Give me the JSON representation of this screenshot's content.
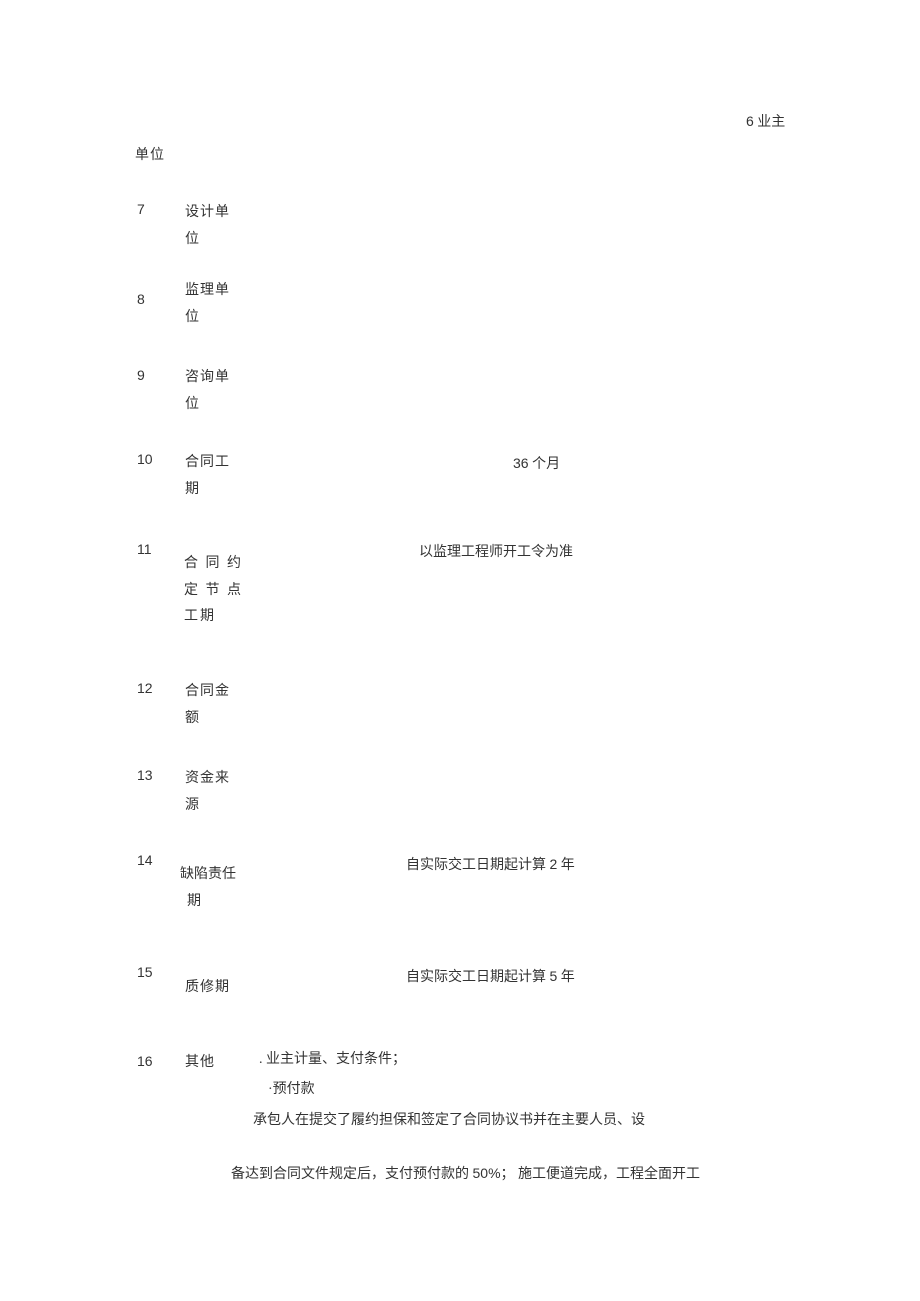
{
  "header": {
    "right_num": "6",
    "right_text": " 业主",
    "unit": "单位"
  },
  "rows": [
    {
      "num": "7",
      "label": "设计单\n位",
      "value": ""
    },
    {
      "num": "8",
      "label": "监理单\n位",
      "value": ""
    },
    {
      "num": "9",
      "label": "咨询单\n位",
      "value": ""
    },
    {
      "num": "10",
      "label": "合同工\n期",
      "value_pre": "",
      "value_num": "36",
      "value_post": " 个月"
    },
    {
      "num": "11",
      "label": "合 同 约\n定 节 点\n工期",
      "value": "以监理工程师开工令为准"
    },
    {
      "num": "12",
      "label": "合同金\n额",
      "value": ""
    },
    {
      "num": "13",
      "label": "资金来\n源",
      "value": ""
    },
    {
      "num": "14",
      "label": "缺陷责任\n  期",
      "value_pre": "自实际交工日期起计算 ",
      "value_num": "2",
      "value_post": " 年"
    },
    {
      "num": "15",
      "label": "质修期",
      "value_pre": "自实际交工日期起计算 ",
      "value_num": "5",
      "value_post": " 年"
    },
    {
      "num": "16",
      "label": "其他",
      "value": ""
    }
  ],
  "other": {
    "line1": ". 业主计量、支付条件；",
    "line2": "·预付款",
    "line3_a": "承包人在提交了履约担保和签定了合同协议书并在主要人员、设",
    "line4_a": "备达到合同文件规定后，支付预付款的 ",
    "line4_num": "50%",
    "line4_b": "； 施工便道完成，工程全面开工"
  }
}
